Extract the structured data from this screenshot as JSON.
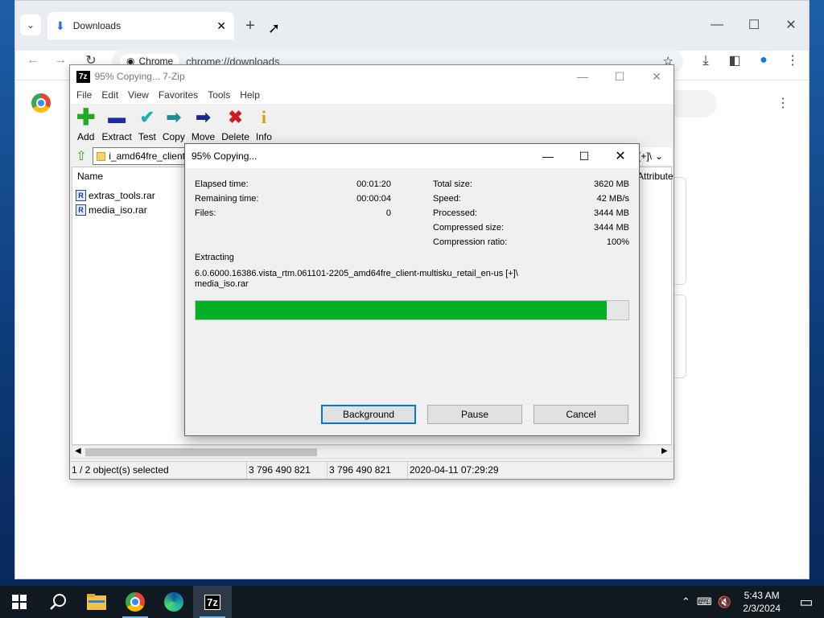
{
  "chrome": {
    "tab_title": "Downloads",
    "new_tab": "+",
    "omnibox_chip": "Chrome",
    "url": "chrome://downloads"
  },
  "zip": {
    "title": "95% Copying... 7-Zip",
    "logo": "7z",
    "menu": [
      "File",
      "Edit",
      "View",
      "Favorites",
      "Tools",
      "Help"
    ],
    "toolbar": [
      {
        "label": "Add",
        "icon": "+",
        "color": "#22aa22"
      },
      {
        "label": "Extract",
        "icon": "▬",
        "color": "#1a2ea8"
      },
      {
        "label": "Test",
        "icon": "✓",
        "color": "#1ab0b8"
      },
      {
        "label": "Copy",
        "icon": "➡",
        "color": "#1a8f8f"
      },
      {
        "label": "Move",
        "icon": "➡",
        "color": "#1a2a8a"
      },
      {
        "label": "Delete",
        "icon": "✖",
        "color": "#d01c1c"
      },
      {
        "label": "Info",
        "icon": "i",
        "color": "#c8a800"
      }
    ],
    "path": "i_amd64fre_client",
    "path_right": "[+]\\",
    "column_name": "Name",
    "column_attr": "Attribute",
    "files": [
      {
        "name": "extras_tools.rar",
        "icon": "R"
      },
      {
        "name": "media_iso.rar",
        "icon": "R"
      }
    ],
    "status": {
      "selected": "1 / 2 object(s) selected",
      "size": "3 796 490 821",
      "packed": "3 796 490 821",
      "modified": "2020-04-11 07:29:29"
    }
  },
  "dialog": {
    "title": "95% Copying...",
    "elapsed_label": "Elapsed time:",
    "elapsed": "00:01:20",
    "remaining_label": "Remaining time:",
    "remaining": "00:00:04",
    "files_label": "Files:",
    "files": "0",
    "total_label": "Total size:",
    "total": "3620 MB",
    "speed_label": "Speed:",
    "speed": "42 MB/s",
    "processed_label": "Processed:",
    "processed": "3444 MB",
    "compressed_label": "Compressed size:",
    "compressed": "3444 MB",
    "ratio_label": "Compression ratio:",
    "ratio": "100%",
    "action": "Extracting",
    "path_line1": "6.0.6000.16386.vista_rtm.061101-2205_amd64fre_client-multisku_retail_en-us [+]\\",
    "path_line2": "media_iso.rar",
    "progress": 0.95,
    "progress_color": "#06b025",
    "btn_background": "Background",
    "btn_pause": "Pause",
    "btn_cancel": "Cancel"
  },
  "taskbar": {
    "time": "5:43 AM",
    "date": "2/3/2024",
    "apps": [
      "windows-start-icon",
      "search-icon",
      "file-explorer-icon",
      "chrome-icon",
      "edge-icon",
      "7zip-icon"
    ]
  }
}
